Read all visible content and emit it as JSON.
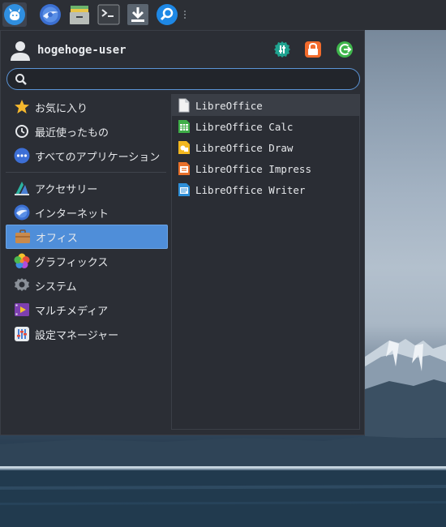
{
  "panel": {
    "launchers": [
      {
        "icon": "whisker-menu-icon",
        "name": "whisker-menu-button"
      },
      {
        "icon": "browser-icon",
        "name": "browser-launcher"
      },
      {
        "icon": "file-manager-icon",
        "name": "file-manager-launcher"
      },
      {
        "icon": "terminal-icon",
        "name": "terminal-launcher"
      },
      {
        "icon": "download-icon",
        "name": "download-launcher"
      },
      {
        "icon": "search-icon",
        "name": "app-finder-launcher"
      }
    ]
  },
  "menu": {
    "user": {
      "name": "hogehoge-user"
    },
    "actions": [
      {
        "icon": "settings-manager-icon",
        "color": "#1fa390"
      },
      {
        "icon": "lock-icon",
        "color": "#f26b2c"
      },
      {
        "icon": "logout-icon",
        "color": "#3fb64c"
      }
    ],
    "search": {
      "value": "",
      "placeholder": ""
    },
    "favorites_section": [
      {
        "label": "お気に入り",
        "icon": "star-icon"
      },
      {
        "label": "最近使ったもの",
        "icon": "clock-icon"
      },
      {
        "label": "すべてのアプリケーション",
        "icon": "all-apps-icon"
      }
    ],
    "categories": [
      {
        "label": "アクセサリー",
        "icon": "accessories-icon"
      },
      {
        "label": "インターネット",
        "icon": "internet-icon"
      },
      {
        "label": "オフィス",
        "icon": "office-icon",
        "selected": true
      },
      {
        "label": "グラフィックス",
        "icon": "graphics-icon"
      },
      {
        "label": "システム",
        "icon": "system-icon"
      },
      {
        "label": "マルチメディア",
        "icon": "multimedia-icon"
      },
      {
        "label": "設定マネージャー",
        "icon": "settings-manager-icon"
      }
    ],
    "apps": [
      {
        "label": "LibreOffice",
        "icon": "libreoffice-icon"
      },
      {
        "label": "LibreOffice Calc",
        "icon": "libreoffice-calc-icon"
      },
      {
        "label": "LibreOffice Draw",
        "icon": "libreoffice-draw-icon"
      },
      {
        "label": "LibreOffice Impress",
        "icon": "libreoffice-impress-icon"
      },
      {
        "label": "LibreOffice Writer",
        "icon": "libreoffice-writer-icon"
      }
    ]
  },
  "colors": {
    "accent": "#4f8ed9",
    "panel": "#2c2f35",
    "menu_bg": "#2b2e35"
  }
}
